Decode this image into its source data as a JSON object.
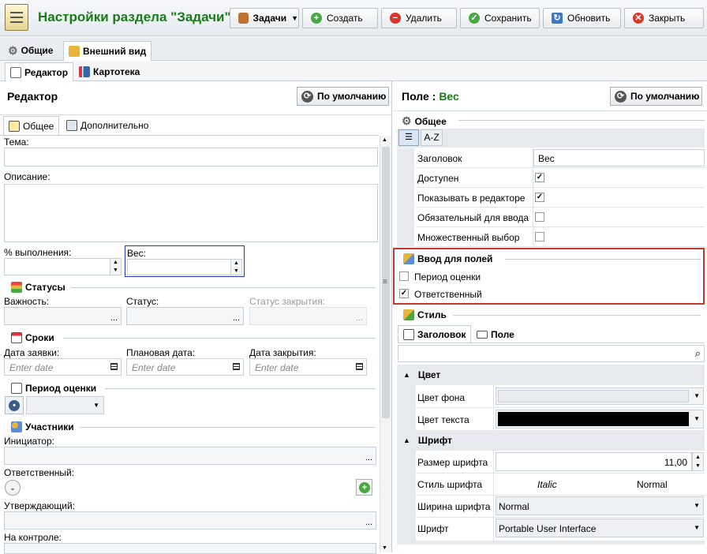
{
  "app": {
    "title": "Настройки раздела \"Задачи\""
  },
  "toolbar": {
    "section_label": "Задачи",
    "create": "Создать",
    "delete": "Удалить",
    "save": "Сохранить",
    "refresh": "Обновить",
    "close": "Закрыть"
  },
  "tabs": {
    "general": "Общие",
    "appearance": "Внешний вид"
  },
  "subtabs": {
    "editor": "Редактор",
    "card": "Картотека"
  },
  "left": {
    "title": "Редактор",
    "default_button": "По умолчанию",
    "tabs": {
      "general": "Общее",
      "extra": "Дополнительно"
    },
    "fields": {
      "subject": "Тема:",
      "description": "Описание:",
      "percent": "% выполнения:",
      "weight": "Вес:"
    },
    "statuses": {
      "title": "Статусы",
      "importance": "Важность:",
      "status": "Статус:",
      "close_status": "Статус закрытия:"
    },
    "deadlines": {
      "title": "Сроки",
      "request_date": "Дата заявки:",
      "planned_date": "Плановая дата:",
      "close_date": "Дата закрытия:",
      "placeholder": "Enter date"
    },
    "period": {
      "title": "Период оценки"
    },
    "participants": {
      "title": "Участники",
      "initiator": "Инициатор:",
      "responsible": "Ответственный:",
      "approver": "Утверждающий:",
      "control": "На контроле:"
    },
    "dots": "..."
  },
  "right": {
    "field_label": "Поле :",
    "field_value": "Вес",
    "default_button": "По умолчанию",
    "general": {
      "title": "Общее",
      "sort_az": "A-Z",
      "rows": [
        {
          "label": "Заголовок",
          "value": "Вес",
          "type": "text"
        },
        {
          "label": "Доступен",
          "checked": true,
          "type": "check"
        },
        {
          "label": "Показывать в редакторе",
          "checked": true,
          "type": "check"
        },
        {
          "label": "Обязательный для ввода",
          "checked": false,
          "type": "check"
        },
        {
          "label": "Множественный выбор",
          "checked": false,
          "type": "check"
        }
      ]
    },
    "input": {
      "title": "Ввод для полей",
      "items": [
        {
          "label": "Период оценки",
          "checked": false
        },
        {
          "label": "Ответственный",
          "checked": true
        }
      ]
    },
    "style": {
      "title": "Стиль",
      "tabs": {
        "header": "Заголовок",
        "field": "Поле"
      },
      "color": {
        "title": "Цвет",
        "bg": "Цвет фона",
        "text": "Цвет текста",
        "bg_value": "#e8ecf0",
        "text_value": "#000000"
      },
      "font": {
        "title": "Шрифт",
        "size_label": "Размер шрифта",
        "size_value": "11,00",
        "style_label": "Стиль шрифта",
        "style_value1": "Italic",
        "style_value2": "Normal",
        "weight_label": "Ширина шрифта",
        "weight_value": "Normal",
        "family_label": "Шрифт",
        "family_value": "Portable User Interface"
      }
    }
  },
  "colors": {
    "title_green": "#1b7a1b",
    "highlight_red": "#c0392b"
  }
}
